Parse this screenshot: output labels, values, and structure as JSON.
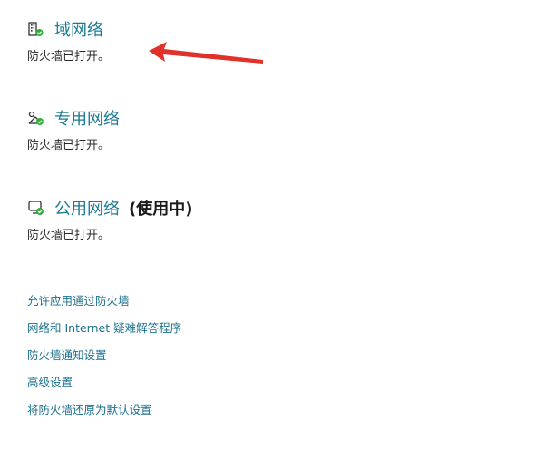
{
  "networks": [
    {
      "title": "域网络",
      "suffix": "",
      "status": "防火墙已打开。",
      "icon": "domain-network-icon"
    },
    {
      "title": "专用网络",
      "suffix": "",
      "status": "防火墙已打开。",
      "icon": "private-network-icon"
    },
    {
      "title": "公用网络",
      "suffix": "(使用中)",
      "status": "防火墙已打开。",
      "icon": "public-network-icon"
    }
  ],
  "links": [
    "允许应用通过防火墙",
    "网络和 Internet 疑难解答程序",
    "防火墙通知设置",
    "高级设置",
    "将防火墙还原为默认设置"
  ],
  "colors": {
    "title": "#1a7a94",
    "link": "#1a6f8c",
    "check": "#2fae3a",
    "arrow": "#e0312a"
  }
}
